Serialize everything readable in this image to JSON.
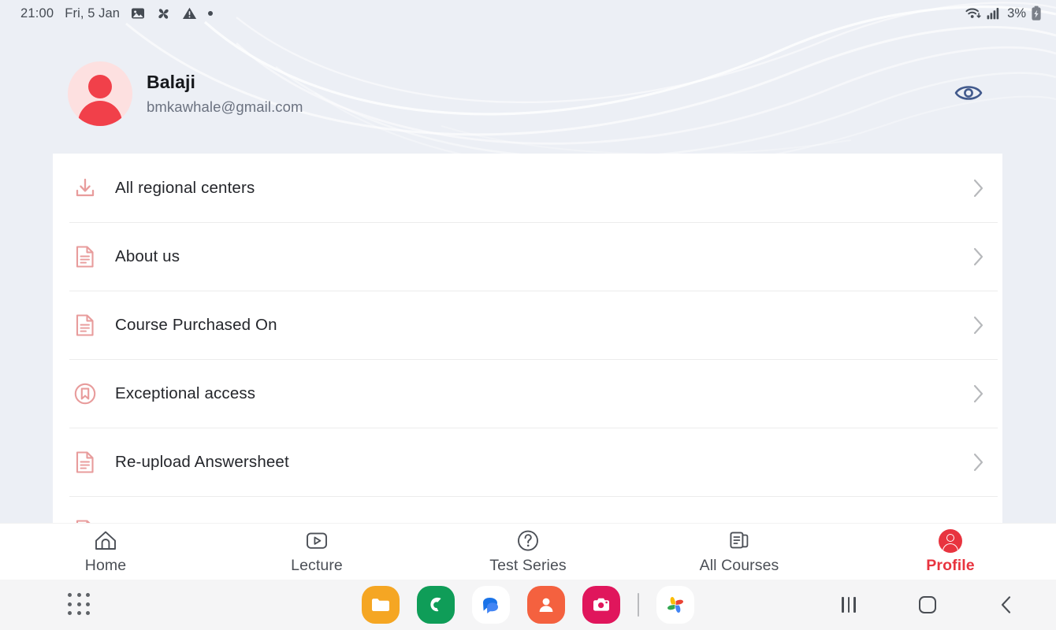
{
  "status_bar": {
    "time": "21:00",
    "date": "Fri, 5 Jan",
    "icons": [
      "image-icon",
      "pinwheel-icon",
      "warning-triangle-icon",
      "dot-indicator-icon"
    ],
    "battery_percent": "3%",
    "wifi": "wifi-icon",
    "signal": "cellular-signal-icon",
    "battery": "battery-charging-icon"
  },
  "header": {
    "user_name": "Balaji",
    "user_email": "bmkawhale@gmail.com",
    "avatar": "user-avatar",
    "eye_action": "eye-icon",
    "bg_color": "#eceff5",
    "accent_color": "#f1404a"
  },
  "menu": {
    "items": [
      {
        "label": "All regional centers",
        "icon": "download-icon"
      },
      {
        "label": "About us",
        "icon": "document-icon"
      },
      {
        "label": "Course Purchased On",
        "icon": "document-icon"
      },
      {
        "label": "Exceptional access",
        "icon": "badge-circle-icon"
      },
      {
        "label": "Re-upload Answersheet",
        "icon": "document-icon"
      }
    ],
    "chevron": "chevron-right-icon",
    "icon_color": "#efa9a9"
  },
  "bottom_nav": {
    "active": "Profile",
    "active_color": "#e8343f",
    "items": [
      {
        "label": "Home",
        "icon": "home-icon"
      },
      {
        "label": "Lecture",
        "icon": "video-play-icon"
      },
      {
        "label": "Test Series",
        "icon": "question-circle-icon"
      },
      {
        "label": "All Courses",
        "icon": "documents-stack-icon"
      },
      {
        "label": "Profile",
        "icon": "profile-avatar-icon"
      }
    ]
  },
  "dock": {
    "apps_button": "app-drawer-icon",
    "apps": [
      {
        "name": "my-files-icon",
        "color": "#f5a623"
      },
      {
        "name": "phone-icon",
        "color": "#0f9d58"
      },
      {
        "name": "messages-icon",
        "color": "#ffffff"
      },
      {
        "name": "contacts-icon",
        "color": "#f4613f"
      },
      {
        "name": "camera-icon",
        "color": "#e0165c"
      },
      {
        "name": "separator",
        "color": "#b9babd"
      },
      {
        "name": "google-photos-icon",
        "color": "#ffffff"
      }
    ],
    "system_buttons": [
      {
        "name": "recents-button",
        "icon": "recents-icon"
      },
      {
        "name": "home-button",
        "icon": "home-square-icon"
      },
      {
        "name": "back-button",
        "icon": "back-chevron-icon"
      }
    ]
  }
}
